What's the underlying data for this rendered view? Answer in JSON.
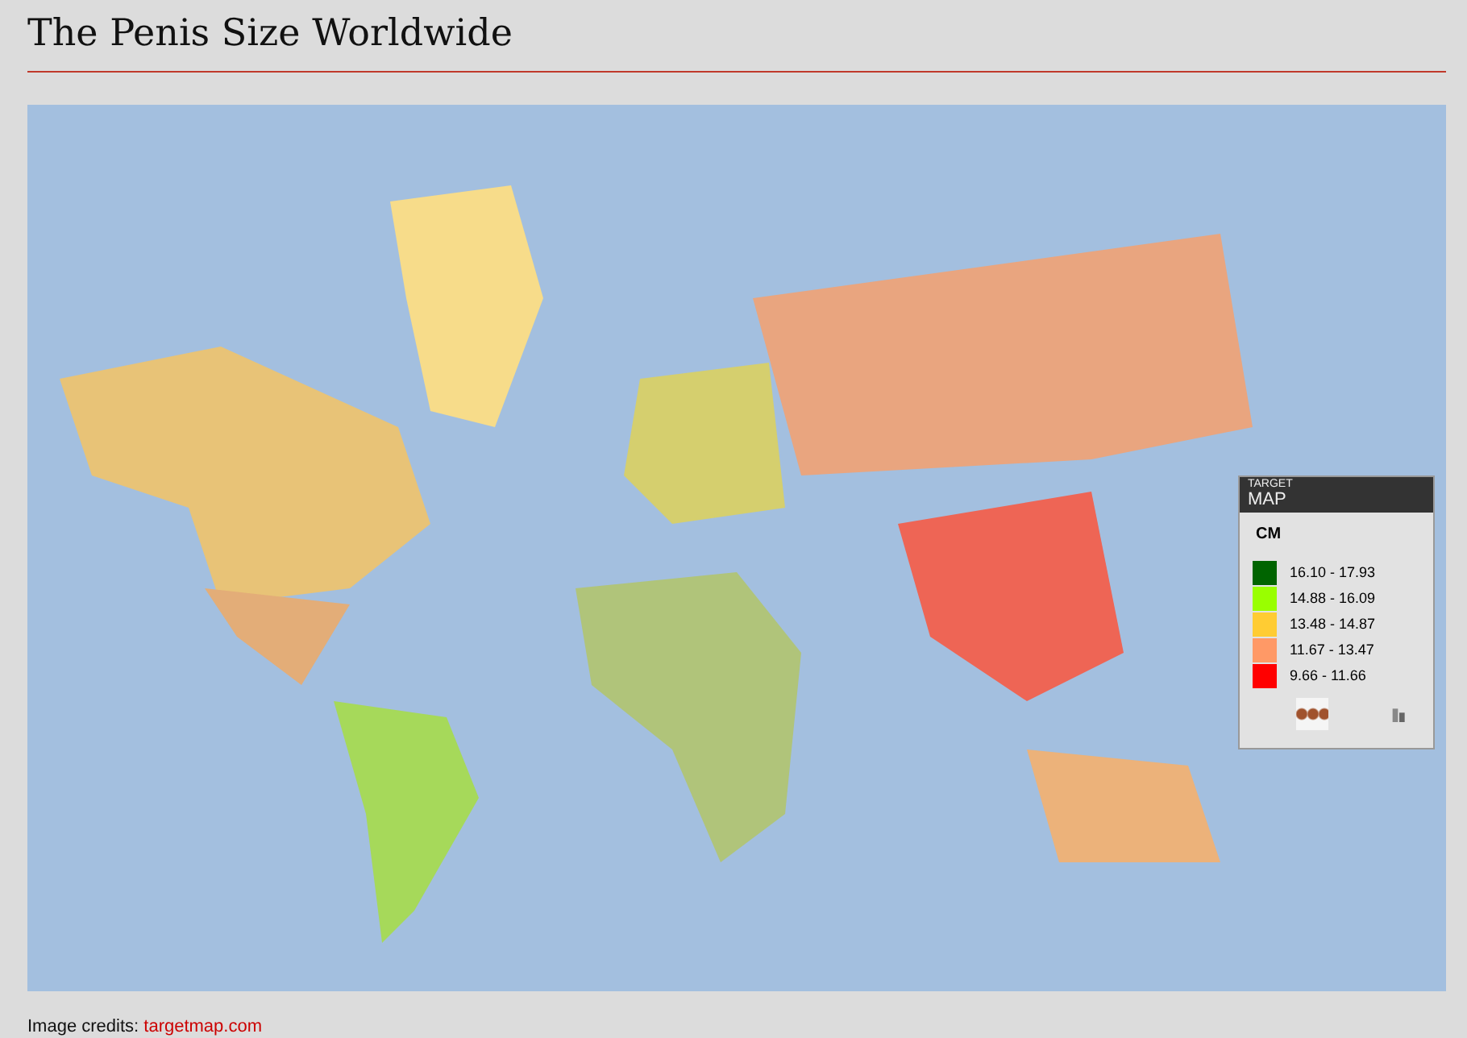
{
  "title": "The Penis Size Worldwide",
  "legend": {
    "logo_top": "TARGET",
    "logo_bottom": "MAP",
    "unit": "CM",
    "items": [
      {
        "label": "16.10 - 17.93",
        "color": "#006400"
      },
      {
        "label": "14.88 - 16.09",
        "color": "#99ff00"
      },
      {
        "label": "13.48 - 14.87",
        "color": "#ffcc33"
      },
      {
        "label": "11.67 - 13.47",
        "color": "#ff9966"
      },
      {
        "label": "9.66 - 11.66",
        "color": "#ff0000"
      }
    ]
  },
  "credits": {
    "label": "Image credits:",
    "link": "targetmap.com"
  }
}
